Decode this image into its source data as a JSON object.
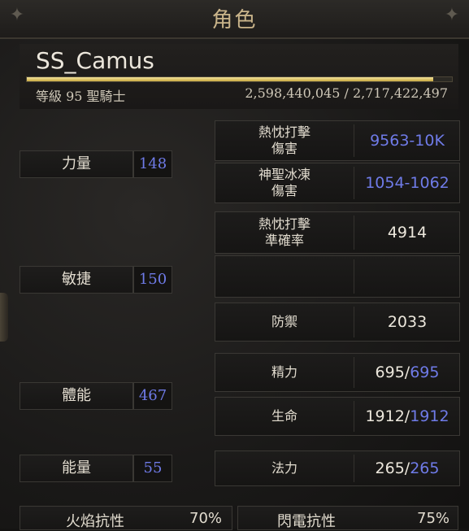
{
  "window": {
    "title": "角色"
  },
  "character": {
    "name": "SS_Camus",
    "level_class": "等級 95 聖騎士",
    "experience_text": "2,598,440,045 / 2,717,422,497",
    "experience_progress": 0.956
  },
  "attributes": [
    {
      "label": "力量",
      "value": "148"
    },
    {
      "label": "敏捷",
      "value": "150"
    },
    {
      "label": "體能",
      "value": "467"
    },
    {
      "label": "能量",
      "value": "55"
    }
  ],
  "combat": {
    "fire_attack_damage": {
      "label_line1": "熱忱打擊",
      "label_line2": "傷害",
      "value": "9563-10K"
    },
    "holy_ice_damage": {
      "label_line1": "神聖冰凍",
      "label_line2": "傷害",
      "value": "1054-1062"
    },
    "attack_rating": {
      "label_line1": "熱忱打擊",
      "label_line2": "準確率",
      "value": "4914"
    },
    "defense": {
      "label": "防禦",
      "value": "2033"
    },
    "stamina": {
      "label": "精力",
      "current": "695",
      "separator": "/",
      "max": "695"
    },
    "life": {
      "label": "生命",
      "current": "1912",
      "separator": "/",
      "max": "1912"
    },
    "mana": {
      "label": "法力",
      "current": "265",
      "separator": "/",
      "max": "265"
    }
  },
  "resistances": {
    "fire": {
      "label": "火焰抗性",
      "value": "70%"
    },
    "lightning": {
      "label": "閃電抗性",
      "value": "75%"
    }
  },
  "colors": {
    "accent_blue": "#6f7be8",
    "title_gold": "#c9b48a",
    "xp_gold": "#e8d37a"
  }
}
